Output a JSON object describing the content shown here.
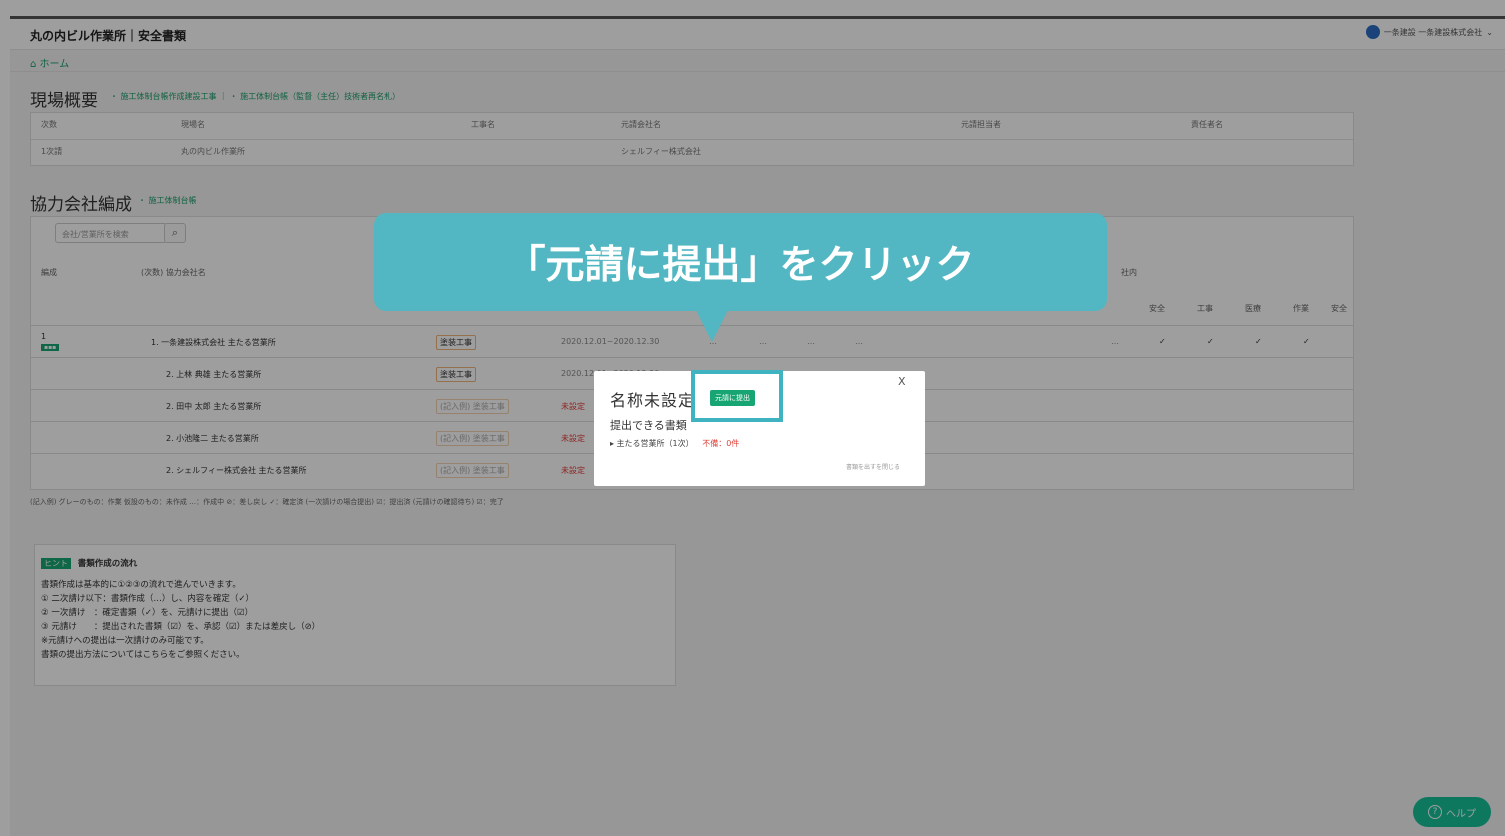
{
  "app": {
    "title": "丸の内ビル作業所｜安全書類",
    "user": "一条建設 一条建設株式会社"
  },
  "breadcrumb": {
    "home": "ホーム"
  },
  "overview": {
    "title": "現場概要",
    "links": "・ 施工体制台帳作成建設工事 ｜ ・ 施工体制台帳（監督（主任）技術者再名札）",
    "headers": [
      "次数",
      "現場名",
      "工事名",
      "元請会社名",
      "元請担当者",
      "責任者名"
    ],
    "row": [
      "1次請",
      "丸の内ビル作業所",
      "",
      "シェルフィー株式会社",
      "",
      ""
    ]
  },
  "partners": {
    "title": "協力会社編成",
    "link": "・ 施工体制台帳",
    "search_placeholder": "会社/営業所を検索",
    "col_headers": [
      "編成",
      "(次数) 協力会社名",
      "社内",
      "安全",
      "工事",
      "医療",
      "作業",
      "安全"
    ],
    "rows": [
      {
        "company": "1. 一条建設株式会社 主たる営業所",
        "trade": "塗装工事",
        "period": "2020.12.01~2020.12.30",
        "status": ""
      },
      {
        "company": "2. 上林 典雄 主たる営業所",
        "trade": "塗装工事",
        "period": "2020.12.01~2020.12.30",
        "status": ""
      },
      {
        "company": "2. 田中 太郎 主たる営業所",
        "trade": "(記入例) 塗装工事",
        "period": "",
        "status": "未設定"
      },
      {
        "company": "2. 小池隆二 主たる営業所",
        "trade": "(記入例) 塗装工事",
        "period": "",
        "status": "未設定"
      },
      {
        "company": "2. シェルフィー株式会社 主たる営業所",
        "trade": "(記入例) 塗装工事",
        "period": "",
        "status": "未設定"
      }
    ],
    "check": "✓",
    "dots": "…",
    "legend": "(記入例) グレーのもの：作業 仮設のもの：未作成 …：作成中 ⊘：差し戻し ✓：確定済 (一次請けの場合提出) ☑：提出済 (元請けの確認待ち) ☑：完了"
  },
  "hint": {
    "badge": "ヒント",
    "title": "書類作成の流れ",
    "lines": [
      "書類作成は基本的に①②③の流れで進んでいきます。",
      "① 二次請け以下：書類作成（…）し、内容を確定（✓）",
      "② 一次請け　：確定書類（✓）を、元請けに提出（☑）",
      "③ 元請け　　：提出された書類（☑）を、承認（☑）または差戻し（⊘）",
      "※元請けへの提出は一次請けのみ可能です。",
      "書類の提出方法についてはこちらをご参照ください。"
    ]
  },
  "modal": {
    "title": "名称未設定",
    "submit_label": "元請に提出",
    "close": "X",
    "subtitle": "提出できる書類",
    "item": "▸ 主たる営業所（1次）",
    "missing": "不備：0件",
    "footer": "書類を出すを閉じる"
  },
  "callout": {
    "text": "「元請に提出」をクリック",
    "color": "#52b7c2"
  },
  "help": {
    "label": "ヘルプ",
    "icon": "?"
  }
}
